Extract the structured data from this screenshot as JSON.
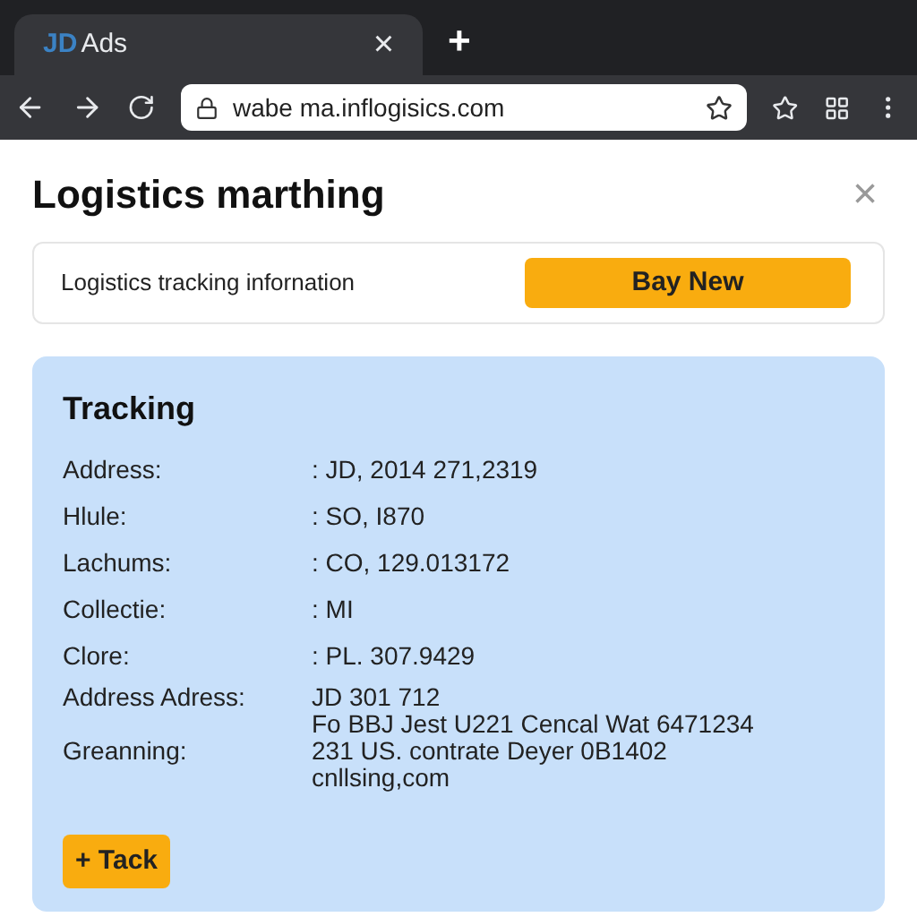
{
  "browser": {
    "tab": {
      "logo": "JD",
      "title": "Ads",
      "close": "×"
    },
    "new_tab": "+",
    "url": "wabe ma.inflogisics.com"
  },
  "dialog": {
    "title": "Logistics marthing",
    "close": "×",
    "info_card": {
      "text": "Logistics tracking infornation",
      "button": "Bay New"
    },
    "tracking": {
      "title": "Tracking",
      "rows": [
        {
          "label": "Address:",
          "value": ": JD, 2014 271,2319"
        },
        {
          "label": "Hlule:",
          "value": ": SO, I870"
        },
        {
          "label": "Lachums:",
          "value": ": CO, 129.013172"
        },
        {
          "label": "Collectie:",
          "value": ": MI"
        },
        {
          "label": "Clore:",
          "value": ": PL. 307.9429"
        }
      ],
      "address_block": [
        {
          "label": "Address Adress:",
          "text": "JD 301 712"
        },
        {
          "text": "Fo BBJ Jest U221 Cencal Wat 6471234"
        },
        {
          "label": "Greanning:",
          "text": "231 US. contrate Deyer 0B1402"
        },
        {
          "text": "cnllsing,com"
        }
      ],
      "button": "+ Tack"
    }
  }
}
